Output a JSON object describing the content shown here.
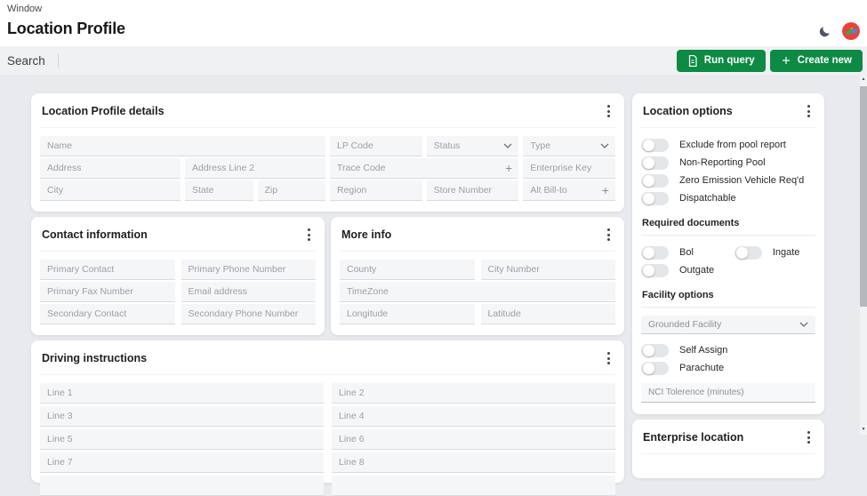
{
  "window_label": "Window",
  "page_title": "Location Profile",
  "toolbar": {
    "search_label": "Search",
    "run_query_label": "Run query",
    "create_new_label": "Create new"
  },
  "icons": {
    "run_query_button": "document-icon",
    "create_new_button": "plus-icon",
    "theme_toggle": "moon-icon",
    "card_menu": "kebab-icon",
    "dropdown": "chevron-down-icon",
    "add_field": "plus-icon",
    "scrollbar": [
      "up-arrow-icon",
      "down-arrow-icon"
    ]
  },
  "colors": {
    "accent_green": "#0d8a43",
    "page_background": "#e8eaed",
    "card_background": "#ffffff",
    "field_background": "#f5f6f8"
  },
  "cards": {
    "profile_details": {
      "title": "Location Profile details",
      "fields": {
        "name": "Name",
        "lp_code": "LP Code",
        "status": "Status",
        "type": "Type",
        "address": "Address",
        "address2": "Address Line 2",
        "trace_code": "Trace Code",
        "enterprise_key": "Enterprise Key",
        "city": "City",
        "state": "State",
        "zip": "Zip",
        "region": "Region",
        "store_number": "Store Number",
        "alt_bill_to": "Alt Bill-to"
      }
    },
    "contact": {
      "title": "Contact information",
      "fields": {
        "primary_contact": "Primary Contact",
        "primary_phone": "Primary Phone Number",
        "primary_fax": "Primary Fax Number",
        "email": "Email address",
        "secondary_contact": "Secondary Contact",
        "secondary_phone": "Secondary Phone Number"
      }
    },
    "more_info": {
      "title": "More info",
      "fields": {
        "county": "County",
        "city_number": "City Number",
        "timezone": "TimeZone",
        "longitude": "Longitude",
        "latitude": "Latitude"
      }
    },
    "driving": {
      "title": "Driving instructions",
      "lines": [
        "Line 1",
        "Line 2",
        "Line 3",
        "Line 4",
        "Line 5",
        "Line 6",
        "Line 7",
        "Line 8"
      ]
    },
    "location_options": {
      "title": "Location options",
      "toggles": [
        "Exclude from pool report",
        "Non-Reporting Pool",
        "Zero Emission Vehicle Req'd",
        "Dispatchable"
      ],
      "required_documents": {
        "heading": "Required documents",
        "toggles": [
          "Bol",
          "Ingate",
          "Outgate"
        ]
      },
      "facility_options": {
        "heading": "Facility options",
        "select_value": "Grounded Facility",
        "toggles": [
          "Self Assign",
          "Parachute"
        ],
        "nci_placeholder": "NCI Tolerence (minutes)"
      }
    },
    "enterprise": {
      "title": "Enterprise location"
    }
  }
}
